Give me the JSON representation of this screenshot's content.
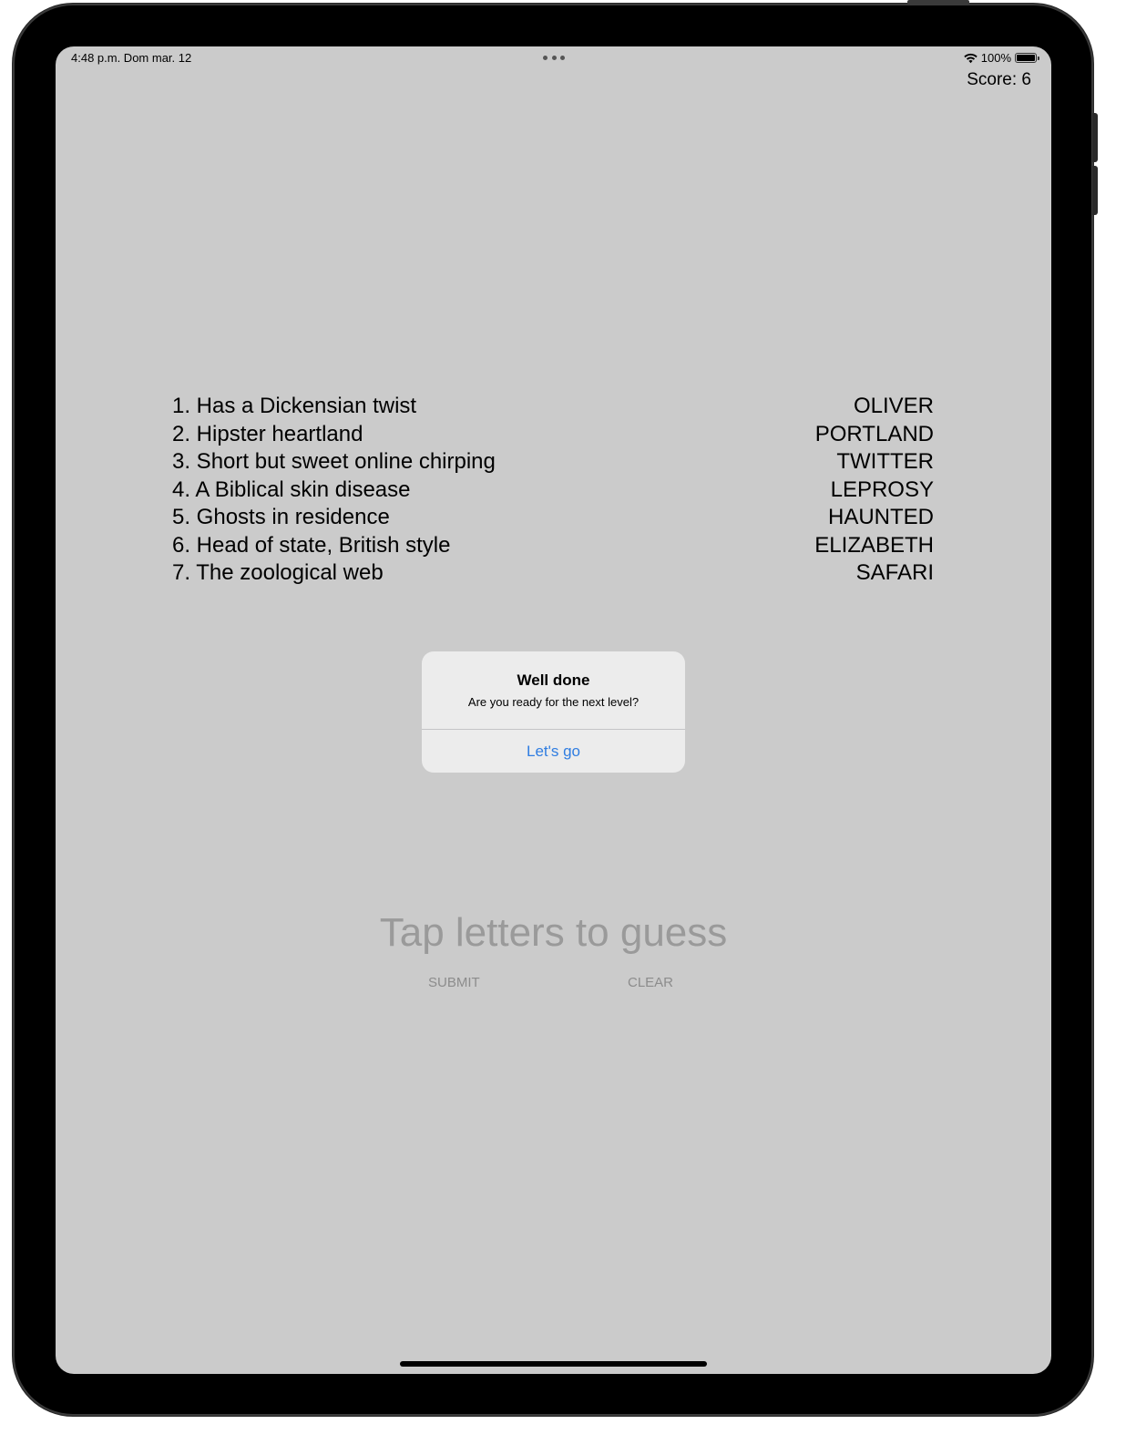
{
  "status_bar": {
    "time_date": "4:48 p.m.   Dom mar. 12",
    "battery": "100%"
  },
  "score": "Score: 6",
  "clues": [
    "1. Has a Dickensian twist",
    "2. Hipster heartland",
    "3. Short but sweet online chirping",
    "4. A Biblical skin disease",
    "5. Ghosts in residence",
    "6. Head of state, British style",
    "7. The zoological web"
  ],
  "answers": [
    "OLIVER",
    "PORTLAND",
    "TWITTER",
    "LEPROSY",
    "HAUNTED",
    "ELIZABETH",
    "SAFARI"
  ],
  "alert": {
    "title": "Well done",
    "message": "Are you ready for the next level?",
    "action": "Let's go"
  },
  "guess_placeholder": "Tap letters to guess",
  "buttons": {
    "submit": "SUBMIT",
    "clear": "CLEAR"
  },
  "colors": {
    "screen_background": "#cbcbcb",
    "alert_action": "#2f7de1",
    "placeholder_text": "#9a9a9a"
  }
}
